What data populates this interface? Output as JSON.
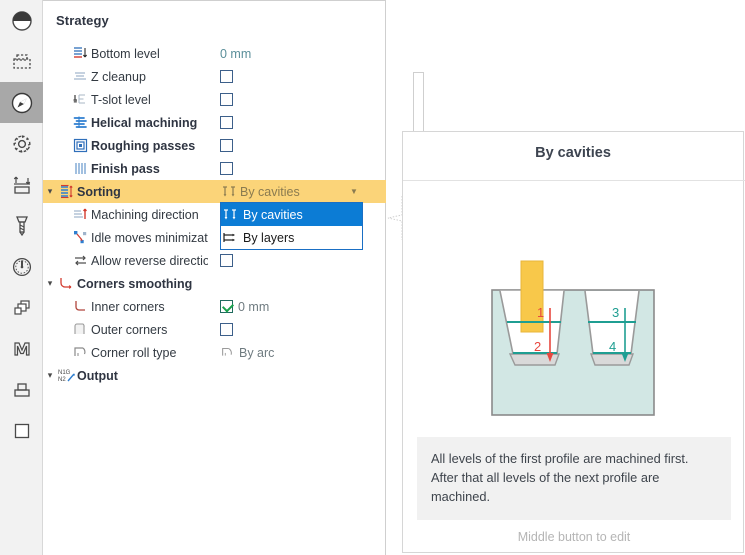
{
  "rail": {
    "items": [
      {
        "name": "pie-view-icon",
        "active": false
      },
      {
        "name": "stock-dashed-icon",
        "active": false
      },
      {
        "name": "compass-icon",
        "active": true
      },
      {
        "name": "gear-icon",
        "active": false
      },
      {
        "name": "machining-levels-icon",
        "active": false
      },
      {
        "name": "end-mill-tool-icon",
        "active": false
      },
      {
        "name": "gauge-icon",
        "active": false
      },
      {
        "name": "layers-icon",
        "active": false
      },
      {
        "name": "m-letter-icon",
        "active": false
      },
      {
        "name": "fixture-icon",
        "active": false
      },
      {
        "name": "square-icon",
        "active": false
      }
    ]
  },
  "panel": {
    "title": "Strategy",
    "rows": [
      {
        "label": "Bottom level",
        "icon": "bottom-level-icon",
        "indent": 1,
        "bold": false,
        "twisty": "",
        "value_type": "text",
        "value": "0 mm"
      },
      {
        "label": "Z cleanup",
        "icon": "z-cleanup-icon",
        "indent": 1,
        "bold": false,
        "twisty": "",
        "value_type": "checkbox",
        "value": ""
      },
      {
        "label": "T-slot level",
        "icon": "t-slot-level-icon",
        "indent": 1,
        "bold": false,
        "twisty": "",
        "value_type": "checkbox",
        "value": ""
      },
      {
        "label": "Helical machining",
        "icon": "helical-machining-icon",
        "indent": 1,
        "bold": true,
        "twisty": "",
        "value_type": "checkbox",
        "value": ""
      },
      {
        "label": "Roughing passes",
        "icon": "roughing-passes-icon",
        "indent": 1,
        "bold": true,
        "twisty": "",
        "value_type": "checkbox",
        "value": ""
      },
      {
        "label": "Finish pass",
        "icon": "finish-pass-icon",
        "indent": 1,
        "bold": true,
        "twisty": "",
        "value_type": "checkbox",
        "value": ""
      },
      {
        "label": "Sorting",
        "icon": "sorting-icon",
        "indent": 0,
        "bold": true,
        "twisty": "v",
        "value_type": "combo",
        "value": "By cavities"
      },
      {
        "label": "Machining direction",
        "icon": "machining-direction-icon",
        "indent": 1,
        "bold": false,
        "twisty": "",
        "value_type": "none",
        "value": ""
      },
      {
        "label": "Idle moves minimization",
        "icon": "idle-moves-icon",
        "indent": 1,
        "bold": false,
        "twisty": "",
        "value_type": "none",
        "value": ""
      },
      {
        "label": "Allow reverse direction",
        "icon": "reverse-direction-icon",
        "indent": 1,
        "bold": false,
        "twisty": "",
        "value_type": "checkbox",
        "value": ""
      },
      {
        "label": "Corners smoothing",
        "icon": "corners-smoothing-icon",
        "indent": 0,
        "bold": true,
        "twisty": "v",
        "value_type": "none",
        "value": ""
      },
      {
        "label": "Inner corners",
        "icon": "inner-corner-icon",
        "indent": 1,
        "bold": false,
        "twisty": "",
        "value_type": "checkbox-value",
        "value": "0 mm"
      },
      {
        "label": "Outer corners",
        "icon": "outer-corner-icon",
        "indent": 1,
        "bold": false,
        "twisty": "",
        "value_type": "checkbox",
        "value": ""
      },
      {
        "label": "Corner roll type",
        "icon": "corner-roll-icon",
        "indent": 1,
        "bold": false,
        "twisty": "",
        "value_type": "icon-text",
        "value": "By arc"
      },
      {
        "label": "Output",
        "icon": "output-nc-icon",
        "indent": 0,
        "bold": true,
        "twisty": "v",
        "value_type": "none",
        "value": ""
      }
    ],
    "dropdown": {
      "open": true,
      "options": [
        {
          "label": "By cavities",
          "icon": "by-cavities-icon",
          "selected": true
        },
        {
          "label": "By layers",
          "icon": "by-layers-icon",
          "selected": false
        }
      ]
    }
  },
  "card": {
    "title": "By cavities",
    "description": "All levels of the first profile are machined first. After that all levels of the next profile are machined.",
    "hint": "Middle button to edit",
    "illustration": {
      "name": "by-cavities-diagram",
      "labels": [
        "1",
        "2",
        "3",
        "4"
      ],
      "left_cavity_labels": [
        "1",
        "2"
      ],
      "right_cavity_labels": [
        "3",
        "4"
      ],
      "left_color": "#e8473f",
      "right_color": "#1f9e92",
      "tool_color": "#f6c councils"
    }
  },
  "colors": {
    "highlight_yellow": "#fbd479",
    "selection_blue": "#0c7cd5",
    "value_teal": "#5b8f9a",
    "rail_active": "#a8a8a8",
    "tool_yellow": "#f8c84a",
    "stock_fill": "#d2e7e4",
    "red_accent": "#e8473f",
    "teal_accent": "#1f9e92"
  }
}
